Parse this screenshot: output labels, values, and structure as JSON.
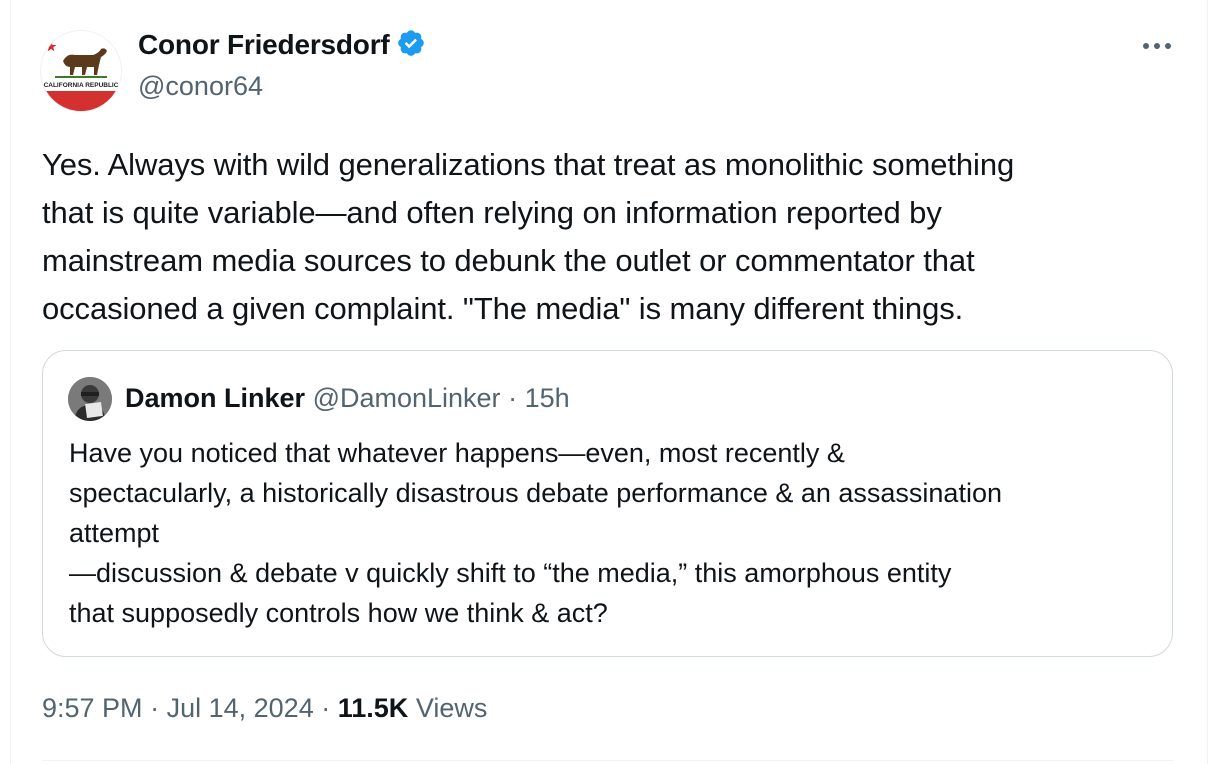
{
  "tweet": {
    "author_name": "Conor Friedersdorf",
    "author_handle": "@conor64",
    "avatar_text": "CALIFORNIA REPUBLIC",
    "verified": true,
    "text": "Yes. Always with wild generalizations that treat as monolithic something\nthat is quite variable—and often relying on information reported by\nmainstream media sources to debunk the outlet or commentator that\noccasioned a given complaint. \"The media\" is many different things.",
    "time": "9:57 PM",
    "date": "Jul 14, 2024",
    "views_count": "11.5K",
    "views_label": "Views",
    "separator": "·"
  },
  "quote": {
    "author_name": "Damon Linker",
    "author_handle": "@DamonLinker",
    "separator": "·",
    "age": "15h",
    "text": "Have you noticed that whatever happens—even, most recently &\nspectacularly, a historically disastrous debate performance & an assassination\nattempt\n—discussion & debate v quickly shift to “the media,” this amorphous entity\nthat supposedly controls how we think & act?"
  },
  "icons": {
    "verified": "verified-badge-icon",
    "more": "more-options-icon"
  },
  "colors": {
    "verified_blue": "#1d9bf0",
    "secondary_text": "#536471",
    "primary_text": "#0f1419",
    "border": "#cfd9de"
  }
}
